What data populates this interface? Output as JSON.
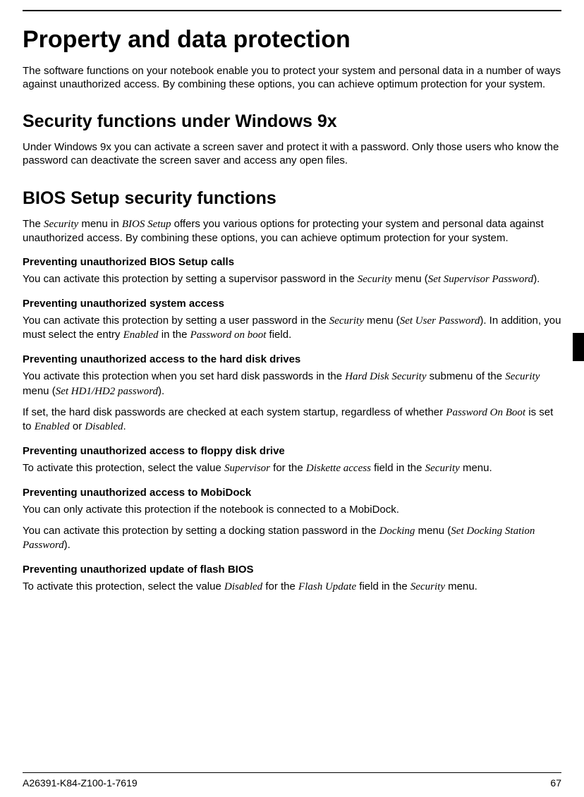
{
  "title": "Property and data protection",
  "intro": "The software functions on your notebook enable you to protect your system and personal data in a number of ways against unauthorized access. By combining these options, you can achieve optimum protection for your system.",
  "section_windows": {
    "heading": "Security functions under Windows 9x",
    "body": "Under Windows 9x you can activate a screen saver and protect it with a password. Only those users who know the password can deactivate the screen saver and access any open files."
  },
  "section_bios": {
    "heading": "BIOS Setup security functions",
    "intro_pre": "The ",
    "intro_i1": "Security",
    "intro_mid1": " menu in ",
    "intro_i2": "BIOS Setup",
    "intro_post": " offers you various options for protecting your system and personal data against unauthorized access. By combining these options, you can achieve optimum protection for your system.",
    "sub1": {
      "heading": "Preventing unauthorized BIOS Setup calls",
      "p_pre": "You can activate this protection by setting a supervisor password in the ",
      "p_i1": "Security",
      "p_mid": " menu (",
      "p_i2": "Set Supervisor Password",
      "p_post": ")."
    },
    "sub2": {
      "heading": "Preventing unauthorized system access",
      "p_pre": "You can activate this protection by setting a user password in the ",
      "p_i1": "Security",
      "p_mid1": " menu (",
      "p_i2": "Set User Password",
      "p_mid2": "). In addition, you must select the entry ",
      "p_i3": "Enabled",
      "p_mid3": " in the ",
      "p_i4": "Password on boot",
      "p_post": " field."
    },
    "sub3": {
      "heading": "Preventing unauthorized access to the hard disk drives",
      "p1_pre": "You activate this protection when you set hard disk passwords in the ",
      "p1_i1": "Hard Disk Security",
      "p1_mid1": " submenu of the ",
      "p1_i2": "Security",
      "p1_mid2": " menu (",
      "p1_i3": "Set HD1/HD2 password",
      "p1_post": ").",
      "p2_pre": "If set, the hard disk passwords are checked at each system startup, regardless of whether ",
      "p2_i1": "Password On Boot",
      "p2_mid1": " is set to ",
      "p2_i2": "Enabled",
      "p2_mid2": " or ",
      "p2_i3": "Disabled",
      "p2_post": "."
    },
    "sub4": {
      "heading": "Preventing unauthorized access to floppy disk drive",
      "p_pre": "To activate this protection, select the value ",
      "p_i1": "Supervisor",
      "p_mid1": " for the ",
      "p_i2": "Diskette access",
      "p_mid2": " field in the ",
      "p_i3": "Security",
      "p_post": " menu."
    },
    "sub5": {
      "heading": "Preventing unauthorized access to MobiDock",
      "p1": "You can only activate this protection if the notebook is connected to a MobiDock.",
      "p2_pre": "You can activate this protection by setting a docking station password in the ",
      "p2_i1": "Docking",
      "p2_mid": " menu (",
      "p2_i2": "Set Docking Station Password",
      "p2_post": ")."
    },
    "sub6": {
      "heading": "Preventing unauthorized update of flash BIOS",
      "p_pre": "To activate this protection, select the value ",
      "p_i1": "Disabled",
      "p_mid1": " for the ",
      "p_i2": "Flash Update",
      "p_mid2": " field in the ",
      "p_i3": "Security",
      "p_post": " menu."
    }
  },
  "footer_left": "A26391-K84-Z100-1-7619",
  "footer_right": "67"
}
